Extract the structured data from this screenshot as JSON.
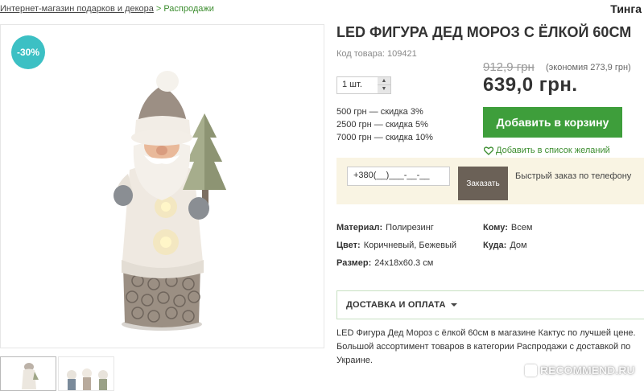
{
  "breadcrumb": {
    "home": "Интернет-магазин подарков и декора",
    "separator": ">",
    "category": "Распродажи"
  },
  "top_right": "Тинга",
  "badge": "-30%",
  "product": {
    "title": "LED ФИГУРА ДЕД МОРОЗ С ЁЛКОЙ 60СМ",
    "sku_label": "Код товара:",
    "sku_value": "109421",
    "old_price": "912,9 грн",
    "saving": "(экономия 273,9 грн)",
    "new_price": "639,0 грн.",
    "quantity": "1 шт.",
    "qty_up": "▲",
    "qty_down": "▼",
    "discounts": [
      "500 грн — скидка 3%",
      "2500 грн — скидка 5%",
      "7000 грн — скидка 10%"
    ],
    "add_to_cart": "Добавить в корзину",
    "wishlist": "Добавить в список желаний"
  },
  "quick_order": {
    "phone_value": "+380(__)___-__-__",
    "button": "Заказать",
    "label": "Быстрый заказ по телефону"
  },
  "properties": [
    {
      "label": "Материал:",
      "value": "Полирезинг"
    },
    {
      "label": "Цвет:",
      "value": "Коричневый, Бежевый"
    },
    {
      "label": "Размер:",
      "value": "24x18x60.3 см"
    },
    {
      "label": "Кому:",
      "value": "Всем"
    },
    {
      "label": "Куда:",
      "value": "Дом"
    }
  ],
  "delivery_tab": "ДОСТАВКА И ОПЛАТА",
  "description": "LED Фигура Дед Мороз с ёлкой 60см в магазине Кактус по лучшей цене. Большой ассортимент товаров в категории Распродажи с доставкой по Украине.",
  "watermark": "RECOMMEND.RU",
  "colors": {
    "accent_green": "#3e9e3b",
    "badge_teal": "#3cc0c4",
    "quick_bg": "#f9f4e3",
    "quick_button": "#6b6157"
  }
}
